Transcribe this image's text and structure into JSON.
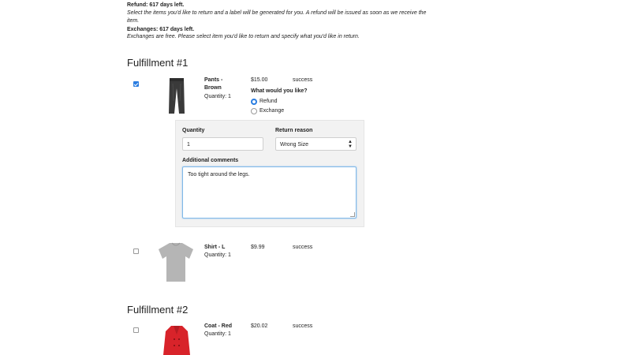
{
  "policy": {
    "refund_title": "Refund: 617 days left.",
    "refund_text": "Select the items you'd like to return and a label will be generated for you. A refund will be issued as soon as we receive the item.",
    "exchange_title": "Exchanges: 617 days left.",
    "exchange_text": "Exchanges are free. Please select item you'd like to return and specify what you'd like in return."
  },
  "fulfillments": [
    {
      "title": "Fulfillment #1",
      "items": [
        {
          "name": "Pants - Brown",
          "quantity": "Quantity: 1",
          "price": "$15.00",
          "status": "success",
          "checked": true,
          "choice_label": "What would you like?",
          "options": [
            "Refund",
            "Exchange"
          ],
          "selected_option": "Refund",
          "form": {
            "quantity_label": "Quantity",
            "quantity_value": "1",
            "reason_label": "Return reason",
            "reason_value": "Wrong Size",
            "comments_label": "Additional comments",
            "comments_value": "Too tight around the legs."
          }
        },
        {
          "name": "Shirt - L",
          "quantity": "Quantity: 1",
          "price": "$9.99",
          "status": "success",
          "checked": false
        }
      ]
    },
    {
      "title": "Fulfillment #2",
      "items": [
        {
          "name": "Coat - Red",
          "quantity": "Quantity: 1",
          "price": "$20.02",
          "status": "success",
          "checked": false
        }
      ]
    }
  ],
  "colors": {
    "accent": "#2a7de1",
    "panel": "#f2f2f2",
    "pants": "#3a3a3a",
    "shirt": "#b5b5b5",
    "coat": "#d8232a"
  },
  "icons": {
    "select_caret": "up-down-caret-icon"
  }
}
